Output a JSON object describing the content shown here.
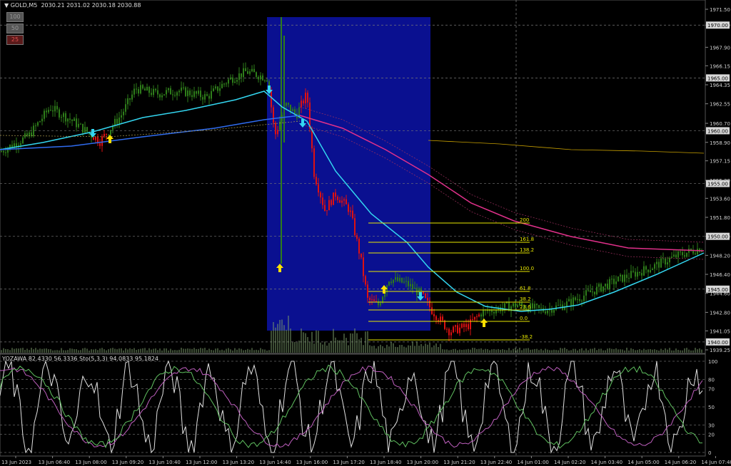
{
  "header": {
    "symbol": "GOLD,M5",
    "ohlc": "2030.21 2031.02 2030.18 2030.88"
  },
  "level_buttons": [
    "100",
    "50",
    "25"
  ],
  "price_axis": {
    "ticks": [
      "1971.50",
      "1970.00",
      "1967.90",
      "1966.15",
      "1964.35",
      "1962.55",
      "1960.70",
      "1958.90",
      "1957.15",
      "1955.30",
      "1953.60",
      "1951.80",
      "1950.00",
      "1948.20",
      "1946.40",
      "1944.60",
      "1942.80",
      "1941.05",
      "1939.25"
    ],
    "boxed": [
      "1970.00",
      "1965.00",
      "1960.00",
      "1955.00",
      "1950.00",
      "1945.00",
      "1940.00"
    ]
  },
  "fib_labels": [
    "200",
    "161.8",
    "138.2",
    "100.0",
    "61.8",
    "38.2",
    "23.6",
    "0.0",
    "-38.2"
  ],
  "subwindow": {
    "title": "YOZAWA 82.4330 56.3336  Sto(5,3,3) 94.0833 95.1824",
    "levels": [
      "100",
      "80",
      "70",
      "50",
      "30",
      "20",
      "0"
    ]
  },
  "time_axis": [
    "13 Jun 2023",
    "13 Jun 06:40",
    "13 Jun 08:00",
    "13 Jun 09:20",
    "13 Jun 10:40",
    "13 Jun 12:00",
    "13 Jun 13:20",
    "13 Jun 14:40",
    "13 Jun 16:00",
    "13 Jun 17:20",
    "13 Jun 18:40",
    "13 Jun 20:00",
    "13 Jun 21:20",
    "13 Jun 22:40",
    "14 Jun 01:00",
    "14 Jun 02:20",
    "14 Jun 03:40",
    "14 Jun 05:00",
    "14 Jun 06:20",
    "14 Jun 07:40"
  ],
  "colors": {
    "background": "#000000",
    "up_bar": "#2e7d1a",
    "down_bar": "#dd1111",
    "session_box": "#0a1090",
    "fast_ma": "#33d6f0",
    "slow_ma": "#e0308a",
    "fib": "#e8e800",
    "signal_up": "#ffe000",
    "signal_down": "#33d6f0"
  }
}
